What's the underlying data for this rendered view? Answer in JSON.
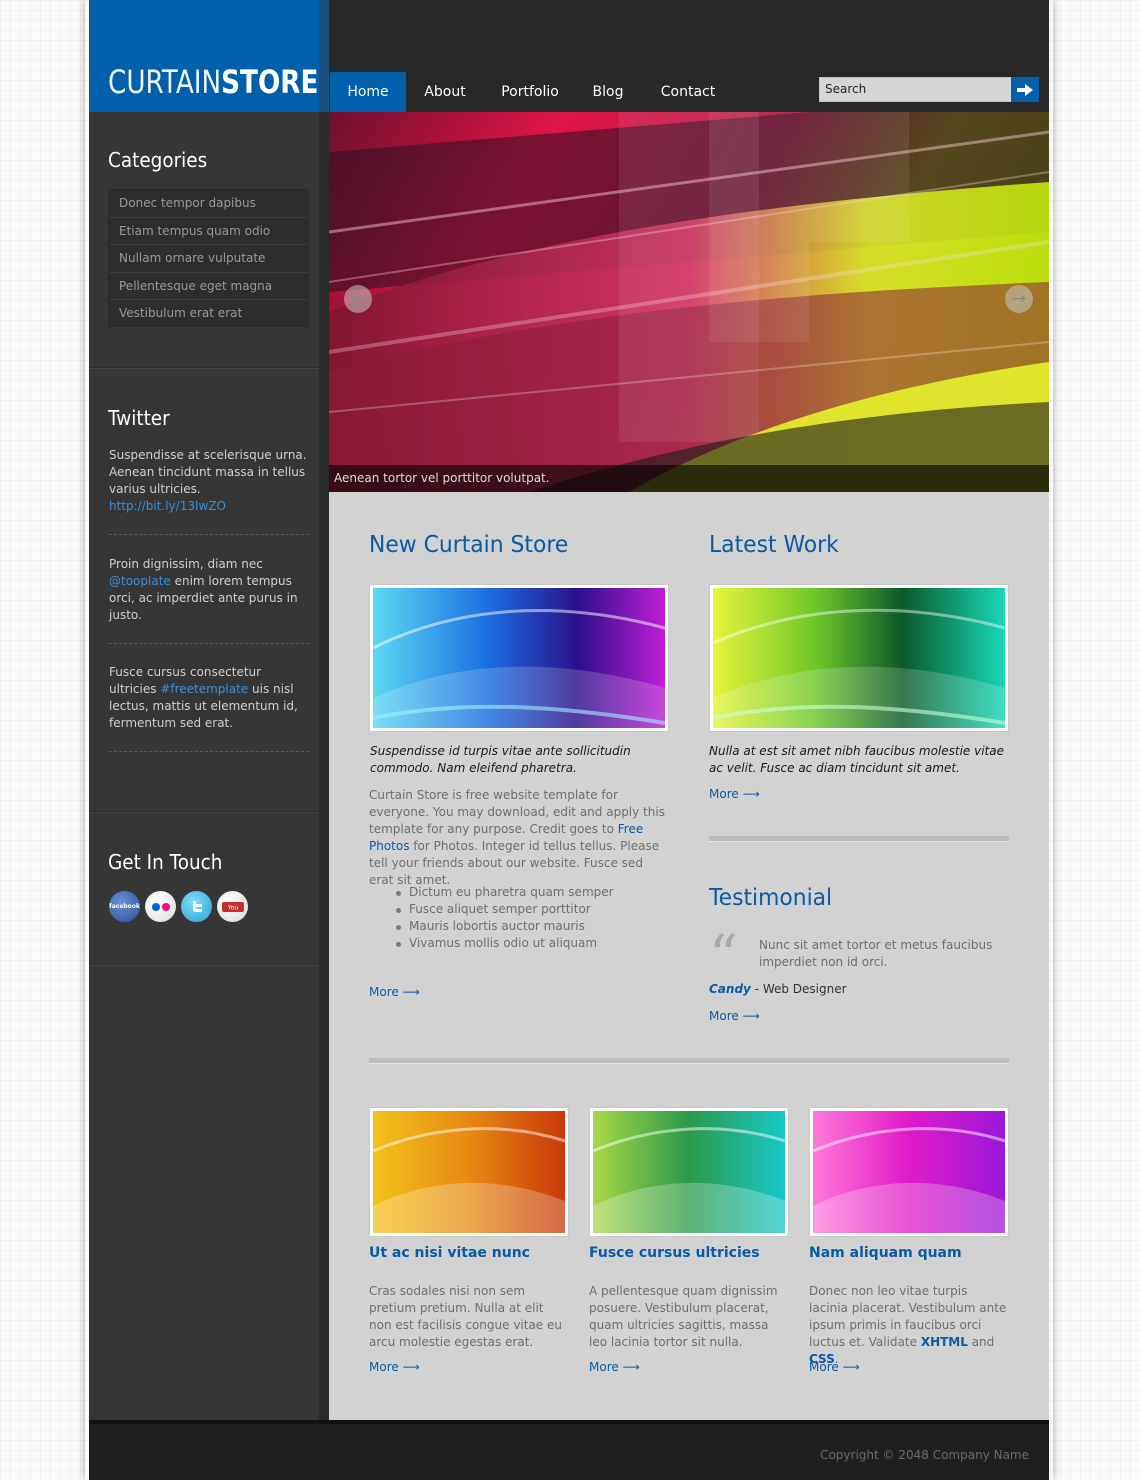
{
  "logo": {
    "part1": "CURTAIN",
    "part2": "STORE"
  },
  "nav": {
    "home": "Home",
    "about": "About",
    "portfolio": "Portfolio",
    "blog": "Blog",
    "contact": "Contact"
  },
  "search": {
    "value": "Search"
  },
  "slider": {
    "caption": "Aenean tortor vel porttitor volutpat."
  },
  "sidebar": {
    "categories": {
      "title": "Categories",
      "items": [
        "Donec tempor dapibus",
        "Etiam tempus quam odio",
        "Nullam ornare vulputate",
        "Pellentesque eget magna",
        "Vestibulum erat erat"
      ]
    },
    "twitter": {
      "title": "Twitter",
      "tweets": [
        {
          "text": "Suspendisse at scelerisque urna. Aenean tincidunt massa in tellus varius ultricies. ",
          "link": "http://bit.ly/13IwZO",
          "after": ""
        },
        {
          "text": "Proin dignissim, diam nec ",
          "link": "@tooplate",
          "after": " enim lorem tempus orci, ac imperdiet ante purus in justo."
        },
        {
          "text": "Fusce cursus consectetur ultricies ",
          "link": "#freetemplate",
          "after": " uis nisl lectus, mattis ut elementum id, fermentum sed erat."
        }
      ]
    },
    "contact": {
      "title": "Get In Touch",
      "social": [
        "facebook",
        "flickr",
        "twitter",
        "youtube"
      ]
    }
  },
  "main": {
    "new_store": {
      "title": "New Curtain Store",
      "lead": "Suspendisse id turpis vitae ante sollicitudin commodo. Nam eleifend pharetra.",
      "body_before": "Curtain Store is free website template for everyone. You may download, edit and apply this template for any purpose. Credit goes to ",
      "body_link": "Free Photos",
      "body_after": " for Photos. Integer id tellus tellus. Please tell your friends about our website. Fusce sed erat sit amet.",
      "bullets": [
        "Dictum eu pharetra quam semper",
        "Fusce aliquet semper porttitor",
        "Mauris lobortis auctor mauris",
        "Vivamus mollis odio ut aliquam"
      ],
      "more": "More"
    },
    "latest_work": {
      "title": "Latest Work",
      "lead": "Nulla at est sit amet nibh faucibus molestie vitae ac velit. Fusce ac diam tincidunt sit amet.",
      "more": "More"
    },
    "testimonial": {
      "title": "Testimonial",
      "quote": "Nunc sit amet tortor et metus faucibus imperdiet non id orci.",
      "name": "Candy",
      "role": " - Web Designer",
      "more": "More"
    },
    "cards": [
      {
        "title": "Ut ac nisi vitae nunc",
        "text": "Cras sodales nisi non sem pretium pretium. Nulla at elit non est facilisis congue vitae eu arcu molestie egestas erat.",
        "more": "More"
      },
      {
        "title": "Fusce cursus ultricies",
        "text": "A pellentesque quam dignissim posuere. Vestibulum placerat, quam ultricies sagittis, massa leo lacinia tortor sit nulla.",
        "more": "More"
      },
      {
        "title": "Nam aliquam quam",
        "text_before": "Donec non leo vitae turpis lacinia placerat. Vestibulum ante ipsum primis in faucibus orci luctus et. Validate ",
        "xhtml": "XHTML",
        "and": " and ",
        "css": "CSS",
        "dot": ".",
        "more": "More"
      }
    ]
  },
  "footer": {
    "copyright": "Copyright © 2048 Company Name"
  }
}
